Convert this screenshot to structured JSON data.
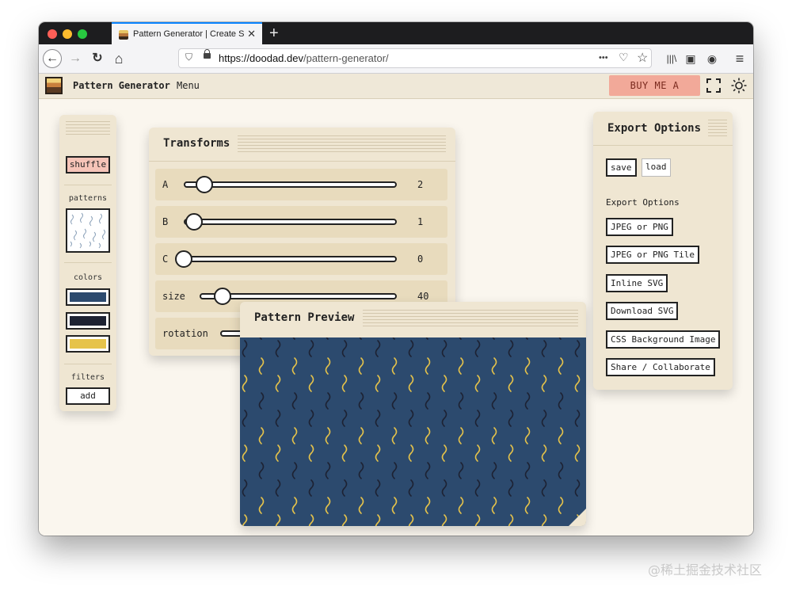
{
  "browser": {
    "tab_title": "Pattern Generator | Create Sea",
    "tab_close": "✕",
    "new_tab": "+",
    "url_domain": "https://doodad.dev",
    "url_path": "/pattern-generator/",
    "back_icon": "←",
    "forward_icon": "→",
    "reload_icon": "↻",
    "home_icon": "⌂",
    "more_icon": "•••",
    "pocket_icon": "♡",
    "star_icon": "☆",
    "library_icon": "|||\\",
    "sidebar_icon": "▣",
    "account_icon": "◉",
    "menu_icon": "≡",
    "traffic_lights": [
      "#ff5f57",
      "#febc2e",
      "#28c840"
    ]
  },
  "app": {
    "title": "Pattern Generator",
    "menu_label": "Menu",
    "coffee_label": "BUY ME A COFFEE",
    "fullscreen_icon": "fullscreen-icon",
    "theme_icon": "sun-icon"
  },
  "sidebar": {
    "shuffle_label": "shuffle",
    "patterns_label": "patterns",
    "colors_label": "colors",
    "colors": [
      "#2c4a6e",
      "#1d2233",
      "#e6c34a"
    ],
    "filters_label": "filters",
    "add_label": "add"
  },
  "transforms": {
    "title": "Transforms",
    "rows": [
      {
        "label": "A",
        "value": "2"
      },
      {
        "label": "B",
        "value": "1"
      },
      {
        "label": "C",
        "value": "0"
      },
      {
        "label": "size",
        "value": "40"
      },
      {
        "label": "rotation",
        "value": ""
      }
    ]
  },
  "preview": {
    "title": "Pattern Preview",
    "background": "#2c4a6e",
    "stroke_colors": [
      "#1d2233",
      "#e6c34a"
    ]
  },
  "export": {
    "title": "Export Options",
    "save_label": "save",
    "load_label": "load",
    "section_label": "Export Options",
    "buttons": [
      "JPEG or PNG",
      "JPEG or PNG Tile",
      "Inline SVG",
      "Download SVG",
      "CSS Background Image",
      "Share / Collaborate"
    ]
  },
  "watermark": "@稀土掘金技术社区"
}
